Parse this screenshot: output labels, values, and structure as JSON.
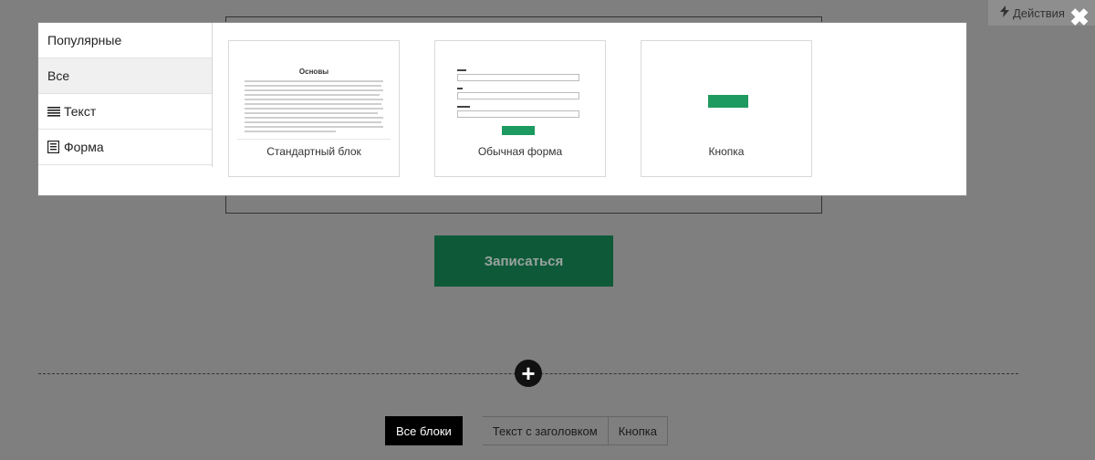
{
  "background": {
    "subscribe_label": "Записаться",
    "add_icon": "plus-icon",
    "tabs": [
      "Все блоки",
      "Текст с заголовком",
      "Кнопка"
    ],
    "actions_label": "Действия",
    "actions_icon": "lightning-icon",
    "close_icon": "close-icon"
  },
  "modal": {
    "sidebar": [
      {
        "label": "Популярные",
        "icon": ""
      },
      {
        "label": "Все",
        "icon": ""
      },
      {
        "label": "Текст",
        "icon": "text-lines-icon"
      },
      {
        "label": "Форма",
        "icon": "form-icon"
      }
    ],
    "selected_category": "Все",
    "cards": [
      {
        "caption": "Стандартный блок",
        "thumb_title": "Основы"
      },
      {
        "caption": "Обычная форма"
      },
      {
        "caption": "Кнопка"
      }
    ]
  },
  "colors": {
    "accent_green": "#1d9a5f",
    "overlay": "#7f7f7f"
  }
}
